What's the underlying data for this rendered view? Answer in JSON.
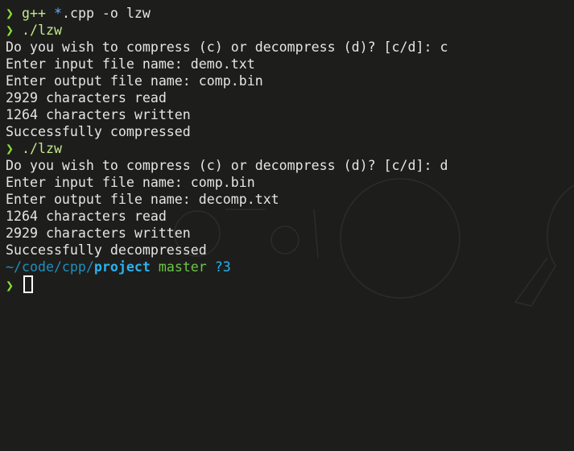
{
  "prompt_symbol": "❯",
  "history": [
    {
      "kind": "command",
      "parts": [
        {
          "text": "g++ ",
          "style": "cmd-green"
        },
        {
          "text": "*",
          "style": "glob"
        },
        {
          "text": ".cpp -o lzw",
          "style": "cmd-plain"
        }
      ]
    },
    {
      "kind": "command",
      "parts": [
        {
          "text": "./lzw",
          "style": "cmd-green"
        }
      ]
    },
    {
      "kind": "output",
      "text": "Do you wish to compress (c) or decompress (d)? [c/d]: c"
    },
    {
      "kind": "output",
      "text": "Enter input file name: demo.txt"
    },
    {
      "kind": "output",
      "text": "Enter output file name: comp.bin"
    },
    {
      "kind": "output",
      "text": "2929 characters read"
    },
    {
      "kind": "output",
      "text": "1264 characters written"
    },
    {
      "kind": "output",
      "text": "Successfully compressed"
    },
    {
      "kind": "command",
      "parts": [
        {
          "text": "./lzw",
          "style": "cmd-green"
        }
      ]
    },
    {
      "kind": "output",
      "text": "Do you wish to compress (c) or decompress (d)? [c/d]: d"
    },
    {
      "kind": "output",
      "text": "Enter input file name: comp.bin"
    },
    {
      "kind": "output",
      "text": "Enter output file name: decomp.txt"
    },
    {
      "kind": "output",
      "text": "1264 characters read"
    },
    {
      "kind": "output",
      "text": "2929 characters written"
    },
    {
      "kind": "output",
      "text": "Successfully decompressed"
    }
  ],
  "prompt_info": {
    "path_prefix": "~/code/cpp/",
    "path_current": "project",
    "branch": "master",
    "git_status": "?3"
  },
  "colors": {
    "background": "#1d1e1c",
    "foreground": "#e5e5e3",
    "prompt_arrow": "#8ae234",
    "path": "#2ab1ef",
    "branch": "#6cc644"
  }
}
